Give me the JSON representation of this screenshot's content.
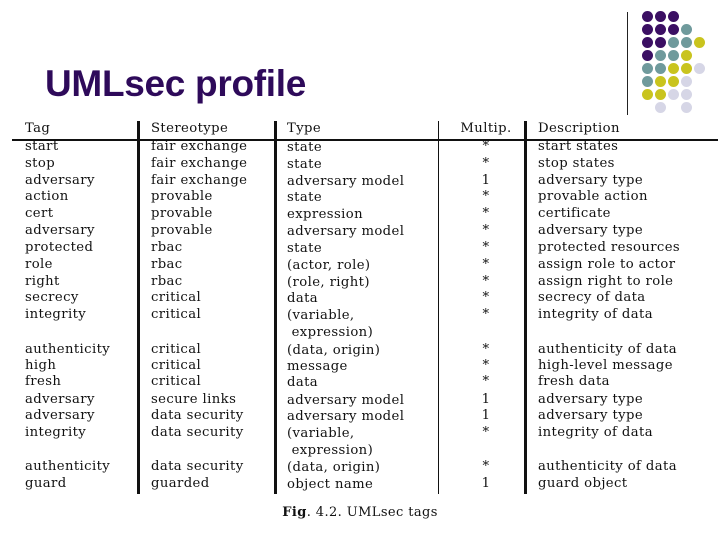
{
  "slide": {
    "title": "UMLsec profile",
    "accent_colors": {
      "title": "#2e0a5a",
      "purple": "#3b0f63",
      "teal": "#6f9a9c",
      "yellow": "#c9c41e",
      "lavender": "#d6d6e6"
    },
    "decoration": {
      "name": "dot-grid-icon",
      "rows": [
        [
          "purple",
          "purple",
          "purple",
          null,
          null
        ],
        [
          "purple",
          "purple",
          "purple",
          "teal",
          null
        ],
        [
          "purple",
          "purple",
          "teal",
          "teal",
          "yellow"
        ],
        [
          "purple",
          "teal",
          "teal",
          "yellow",
          null
        ],
        [
          "teal",
          "teal",
          "yellow",
          "yellow",
          "lavender"
        ],
        [
          "teal",
          "yellow",
          "yellow",
          "lavender",
          null
        ],
        [
          "yellow",
          "yellow",
          "lavender",
          "lavender",
          null
        ],
        [
          null,
          "lavender",
          null,
          "lavender",
          null
        ]
      ]
    }
  },
  "table": {
    "headers": [
      "Tag",
      "Stereotype",
      "Type",
      "Multip.",
      "Description"
    ],
    "rows": [
      {
        "tag": "start",
        "stereotype": "fair exchange",
        "type": "state",
        "mult": "*",
        "description": "start states"
      },
      {
        "tag": "stop",
        "stereotype": "fair exchange",
        "type": "state",
        "mult": "*",
        "description": "stop states"
      },
      {
        "tag": "adversary",
        "stereotype": "fair exchange",
        "type": "adversary model",
        "mult": "1",
        "description": "adversary type"
      },
      {
        "tag": "action",
        "stereotype": "provable",
        "type": "state",
        "mult": "*",
        "description": "provable action"
      },
      {
        "tag": "cert",
        "stereotype": "provable",
        "type": "expression",
        "mult": "*",
        "description": "certificate"
      },
      {
        "tag": "adversary",
        "stereotype": "provable",
        "type": "adversary model",
        "mult": "*",
        "description": "adversary type"
      },
      {
        "tag": "protected",
        "stereotype": "rbac",
        "type": "state",
        "mult": "*",
        "description": "protected resources"
      },
      {
        "tag": "role",
        "stereotype": "rbac",
        "type": "(actor, role)",
        "mult": "*",
        "description": "assign role to actor"
      },
      {
        "tag": "right",
        "stereotype": "rbac",
        "type": "(role, right)",
        "mult": "*",
        "description": "assign right to role"
      },
      {
        "tag": "secrecy",
        "stereotype": "critical",
        "type": "data",
        "mult": "*",
        "description": "secrecy of data"
      },
      {
        "tag": "integrity",
        "stereotype": "critical",
        "type": "(variable,\n expression)",
        "mult": "*",
        "description": "integrity of data"
      },
      {
        "tag": "authenticity",
        "stereotype": "critical",
        "type": "(data, origin)",
        "mult": "*",
        "description": "authenticity of data"
      },
      {
        "tag": "high",
        "stereotype": "critical",
        "type": "message",
        "mult": "*",
        "description": "high-level message"
      },
      {
        "tag": "fresh",
        "stereotype": "critical",
        "type": "data",
        "mult": "*",
        "description": "fresh data"
      },
      {
        "tag": "adversary",
        "stereotype": "secure links",
        "type": "adversary model",
        "mult": "1",
        "description": "adversary type"
      },
      {
        "tag": "adversary",
        "stereotype": "data security",
        "type": "adversary model",
        "mult": "1",
        "description": "adversary type"
      },
      {
        "tag": "integrity",
        "stereotype": "data security",
        "type": "(variable,\n expression)",
        "mult": "*",
        "description": "integrity of data"
      },
      {
        "tag": "authenticity",
        "stereotype": "data security",
        "type": "(data, origin)",
        "mult": "*",
        "description": "authenticity of data"
      },
      {
        "tag": "guard",
        "stereotype": "guarded",
        "type": "object name",
        "mult": "1",
        "description": "guard object"
      }
    ]
  },
  "caption": {
    "label": "Fig",
    "number": ". 4.2.",
    "text": " UMLsec tags"
  }
}
